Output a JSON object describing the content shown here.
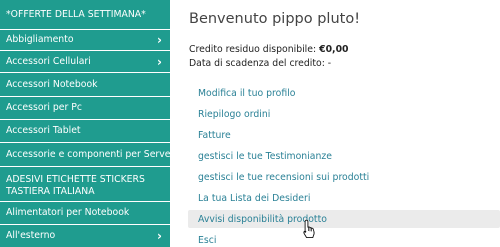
{
  "sidebar": {
    "items": [
      {
        "label": "*OFFERTE DELLA SETTIMANA*",
        "chevron": false
      },
      {
        "label": "Abbigliamento",
        "chevron": true
      },
      {
        "label": "Accessori Cellulari",
        "chevron": true
      },
      {
        "label": "Accessori Notebook",
        "chevron": false
      },
      {
        "label": "Accessori per Pc",
        "chevron": false
      },
      {
        "label": "Accessori Tablet",
        "chevron": false
      },
      {
        "label": "Accessorie e componenti per Server",
        "chevron": false
      },
      {
        "label_line1": "ADESIVI ETICHETTE STICKERS",
        "label_line2": "TASTIERA ITALIANA",
        "chevron": false
      },
      {
        "label": "Alimentatori per Notebook",
        "chevron": false
      },
      {
        "label": "All'esterno",
        "chevron": true
      }
    ],
    "chevron_glyph": "›"
  },
  "main": {
    "welcome": "Benvenuto pippo pluto!",
    "credit_label": "Credito residuo disponibile:",
    "credit_value": "€0,00",
    "expiry_label": "Data di scadenza del credito: -",
    "menu": [
      {
        "label": "Modifica il tuo profilo"
      },
      {
        "label": "Riepilogo ordini"
      },
      {
        "label": "Fatture"
      },
      {
        "label": "gestisci le tue Testimonianze"
      },
      {
        "label": "gestisci le tue recensioni sui prodotti"
      },
      {
        "label": "La tua Lista dei Desideri"
      },
      {
        "label": "Avvisi disponibilità prodotto",
        "hovered": true
      },
      {
        "label": "Esci"
      }
    ]
  },
  "colors": {
    "sidebar_bg": "#1f9c8f",
    "link": "#2a8196",
    "hover_bg": "#ebebeb"
  },
  "icons": {
    "cursor": "hand-pointer-icon",
    "chevron": "chevron-right-icon"
  }
}
